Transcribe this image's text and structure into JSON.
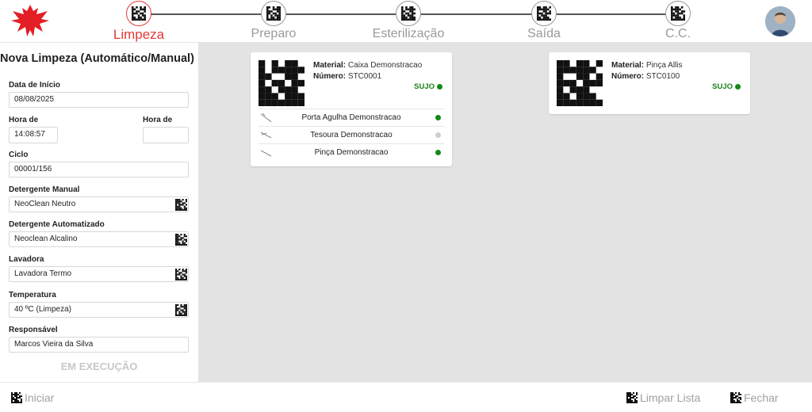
{
  "steps": [
    {
      "label": "Limpeza",
      "active": true
    },
    {
      "label": "Preparo",
      "active": false
    },
    {
      "label": "Esterilização",
      "active": false
    },
    {
      "label": "Saída",
      "active": false
    },
    {
      "label": "C.C.",
      "active": false
    }
  ],
  "colors": {
    "accent": "#e53935",
    "status_green": "#148a14",
    "background": "#e3e3e3"
  },
  "form": {
    "title": "Nova Limpeza (Automático/Manual)",
    "data_inicio": {
      "label": "Data de Início",
      "value": "08/08/2025"
    },
    "hora_inicio": {
      "label": "Hora de Início",
      "value": "14:08:57"
    },
    "hora_final": {
      "label": "Hora de Final",
      "value": ""
    },
    "ciclo": {
      "label": "Ciclo",
      "value": "00001/156"
    },
    "detergente_manual": {
      "label": "Detergente Manual",
      "value": "NeoClean Neutro"
    },
    "detergente_auto": {
      "label": "Detergente Automatizado",
      "value": "Neoclean Alcalino"
    },
    "lavadora": {
      "label": "Lavadora",
      "value": "Lavadora Termo"
    },
    "temperatura": {
      "label": "Temperatura",
      "value": "40 ºC (Limpeza)"
    },
    "responsavel": {
      "label": "Responsável",
      "value": "Marcos Vieira da Silva"
    },
    "status": "EM EXECUÇÃO"
  },
  "cards": [
    {
      "material_label": "Material:",
      "material": "Caixa Demonstracao",
      "numero_label": "Número:",
      "numero": "STC0001",
      "status": "SUJO",
      "items": [
        {
          "name": "Porta Agulha Demonstracao",
          "state": "green"
        },
        {
          "name": "Tesoura Demonstracao",
          "state": "gray"
        },
        {
          "name": "Pinça Demonstracao",
          "state": "green"
        }
      ]
    },
    {
      "material_label": "Material:",
      "material": "Pinça Allis",
      "numero_label": "Número:",
      "numero": "STC0100",
      "status": "SUJO",
      "items": []
    }
  ],
  "footer": {
    "iniciar": "Iniciar",
    "limpar_lista": "Limpar Lista",
    "fechar": "Fechar"
  },
  "icons": {
    "logo": "red-bird-logo-icon",
    "step": "qr-code-icon",
    "field_scan": "qr-code-icon",
    "tool": "surgical-instrument-icon"
  }
}
